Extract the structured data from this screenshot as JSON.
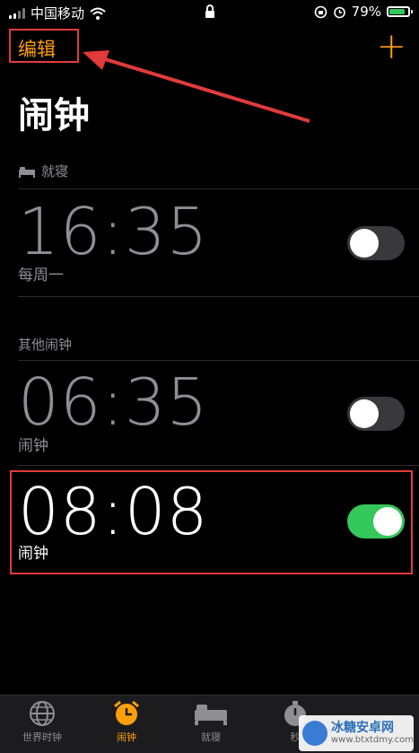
{
  "status_bar": {
    "carrier": "中国移动",
    "battery": "79%",
    "battery_level": 0.79,
    "icons": [
      "cellular-signal-icon",
      "wifi-icon",
      "lock-icon",
      "orientation-lock-icon",
      "alarm-icon",
      "battery-icon"
    ]
  },
  "nav": {
    "edit_label": "编辑",
    "add_label": "+"
  },
  "page_title": "闹钟",
  "bedtime": {
    "header": "就寝",
    "alarm": {
      "time": "16:35",
      "label": "每周一",
      "enabled": false
    }
  },
  "other": {
    "header": "其他闹钟",
    "alarms": [
      {
        "time": "06:35",
        "label": "闹钟",
        "enabled": false
      },
      {
        "time": "08:08",
        "label": "闹钟",
        "enabled": true
      }
    ]
  },
  "tabs": [
    {
      "label": "世界时钟",
      "icon": "globe-icon",
      "active": false
    },
    {
      "label": "闹钟",
      "icon": "alarm-clock-icon",
      "active": true
    },
    {
      "label": "就寝",
      "icon": "bed-icon",
      "active": false
    },
    {
      "label": "秒",
      "icon": "stopwatch-icon",
      "active": false
    }
  ],
  "watermark": {
    "name": "冰糖安卓网",
    "url": "www.btxtdmy.com"
  },
  "colors": {
    "accent": "#ff9f0a",
    "toggle_on": "#34c759",
    "annotation": "#e23b3b"
  }
}
